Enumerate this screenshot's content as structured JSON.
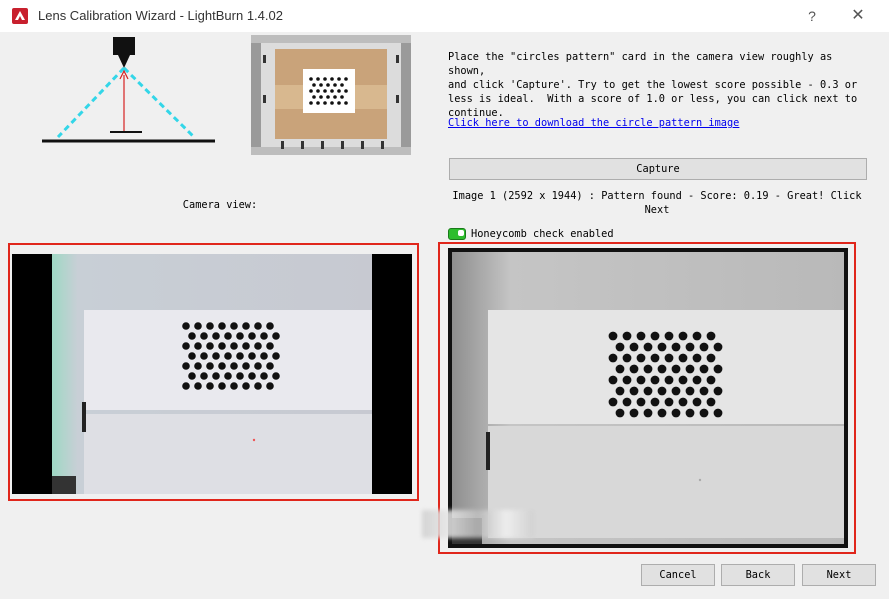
{
  "window": {
    "title": "Lens Calibration Wizard - LightBurn 1.4.02",
    "help_glyph": "?",
    "close_glyph": "✕"
  },
  "instructions": {
    "text": "Place the \"circles pattern\" card in the camera view roughly as shown,\nand click 'Capture'. Try to get the lowest score possible - 0.3 or\nless is ideal.  With a score of 1.0 or less, you can click next to\ncontinue.",
    "download_link": "Click here to download the circle pattern image"
  },
  "capture": {
    "button_label": "Capture",
    "status": "Image 1 (2592 x 1944) : Pattern found - Score: 0.19 - Great! Click Next"
  },
  "camera_view_label": "Camera view:",
  "honeycomb": {
    "label": "Honeycomb check enabled",
    "enabled": true
  },
  "footer": {
    "cancel": "Cancel",
    "back": "Back",
    "next": "Next"
  },
  "colors": {
    "highlight": "#e0261b",
    "link": "#0000ee",
    "toggle_on": "#2cbd2c",
    "cone": "#33d6e8",
    "laser": "#d42020"
  }
}
